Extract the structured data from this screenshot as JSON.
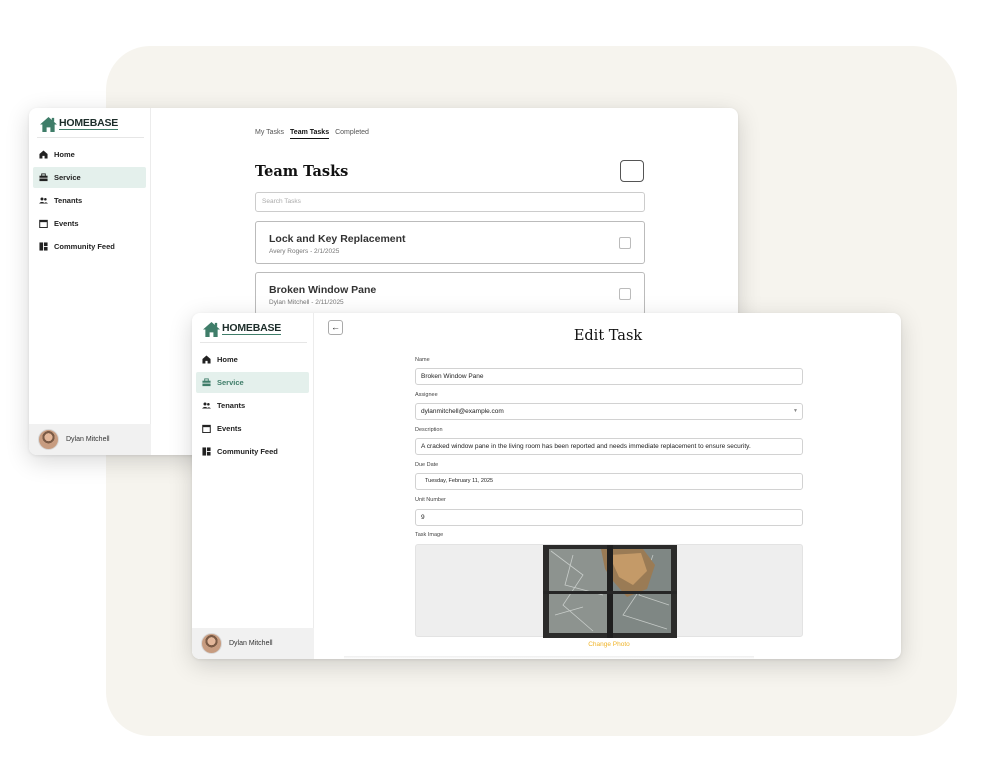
{
  "brand": {
    "logo_text": "HOMEBASE",
    "accent": "#3f7d69",
    "active_bg": "#e4f0ec",
    "link_color": "#f0b429"
  },
  "sidebar": {
    "items": [
      {
        "label": "Home",
        "icon": "home-icon"
      },
      {
        "label": "Service",
        "icon": "toolbox-icon",
        "active": true
      },
      {
        "label": "Tenants",
        "icon": "people-icon"
      },
      {
        "label": "Events",
        "icon": "calendar-icon"
      },
      {
        "label": "Community Feed",
        "icon": "dashboard-icon"
      }
    ],
    "user_name": "Dylan Mitchell"
  },
  "team_tasks": {
    "tabs": [
      "My Tasks",
      "Team Tasks",
      "Completed"
    ],
    "active_tab": "Team Tasks",
    "title": "Team Tasks",
    "search_placeholder": "Search Tasks",
    "tasks": [
      {
        "title": "Lock and Key Replacement",
        "subtitle": "Avery Rogers - 2/1/2025"
      },
      {
        "title": "Broken Window Pane",
        "subtitle": "Dylan Mitchell - 2/11/2025"
      }
    ]
  },
  "edit_task": {
    "back_icon": "arrow-left-icon",
    "title": "Edit Task",
    "fields": {
      "name": {
        "label": "Name",
        "value": "Broken Window Pane"
      },
      "assignee": {
        "label": "Assignee",
        "value": "dylanmitchell@example.com"
      },
      "description": {
        "label": "Description",
        "value": "A cracked window pane in the living room has been reported and needs immediate replacement to ensure security."
      },
      "due_date": {
        "label": "Due Date",
        "value": "Tuesday, February 11, 2025"
      },
      "unit_number": {
        "label": "Unit Number",
        "value": "9"
      },
      "task_image": {
        "label": "Task Image"
      }
    },
    "change_photo_label": "Change Photo"
  }
}
